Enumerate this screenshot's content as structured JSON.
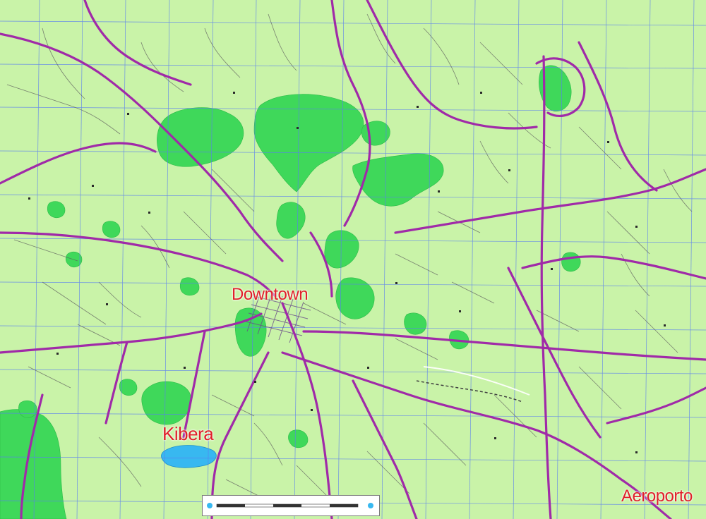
{
  "map": {
    "labels": {
      "downtown": "Downtown",
      "kibera": "Kibera",
      "aeroporto": "Aeroporto"
    },
    "colors": {
      "land": "#c9f3a8",
      "forest": "#3fd85a",
      "major_road": "#a02aa8",
      "minor_road": "#5c5c5c",
      "grid": "#5a7ef0",
      "water": "#38b8f0",
      "callout_text": "#e0202a"
    },
    "features": [
      "grid-lines",
      "forest-areas",
      "major-roads",
      "minor-roads",
      "water-body",
      "scale-legend"
    ]
  }
}
